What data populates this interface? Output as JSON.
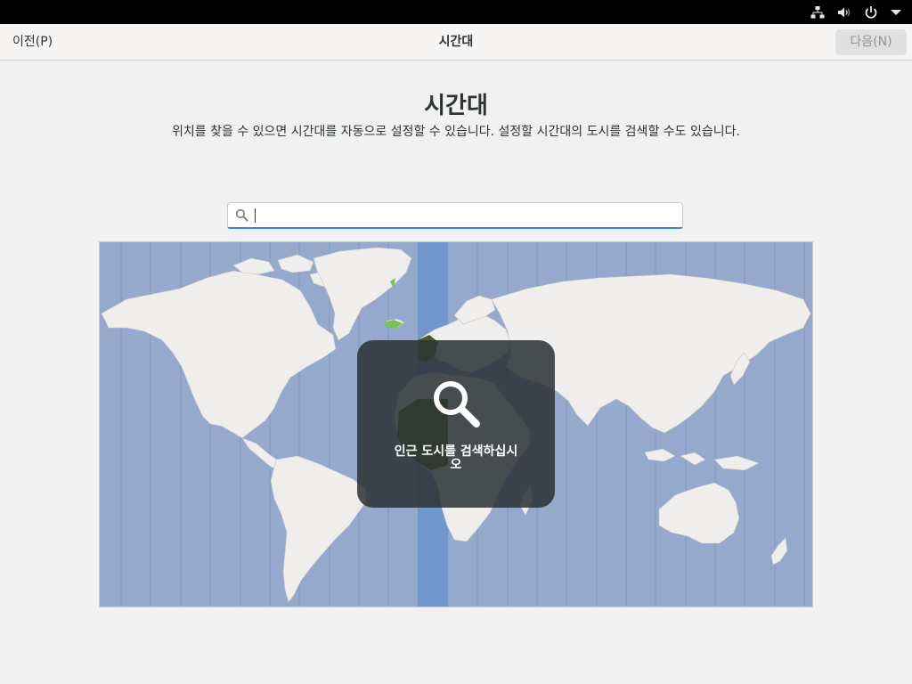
{
  "system_tray": {
    "icons": [
      "network-wired-icon",
      "volume-icon",
      "power-icon",
      "menu-arrow-icon"
    ]
  },
  "header": {
    "prev_label": "이전(P)",
    "title": "시간대",
    "next_label": "다음(N)"
  },
  "main": {
    "title": "시간대",
    "description": "위치를 찾을 수 있으면 시간대를 자동으로 설정할 수 있습니다. 설정할 시간대의 도시를 검색할 수도 있습니다.",
    "search": {
      "value": "",
      "placeholder": "",
      "icon": "search-icon"
    }
  },
  "map": {
    "overlay_icon": "search-icon",
    "overlay_text": "인근 도시를 검색하십시오",
    "colors": {
      "ocean": "#94a9cc",
      "land": "#f0eeec",
      "selected_band": "#7196cc",
      "selected_land": "#4a5c22",
      "accent": "#3584e4"
    }
  }
}
